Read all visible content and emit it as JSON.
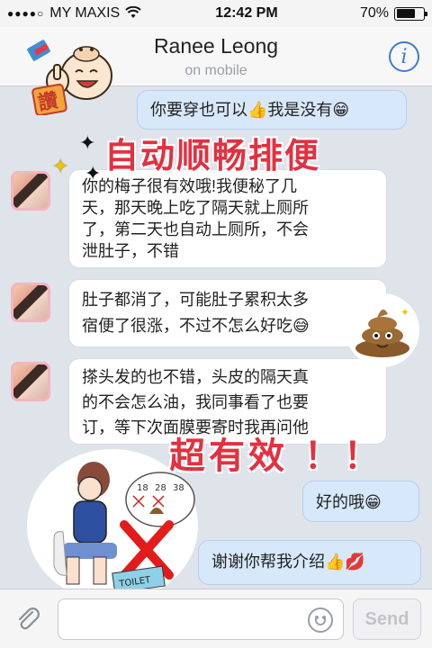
{
  "status_bar": {
    "signal": "●●●●○",
    "carrier": "MY MAXIS",
    "time": "12:42 PM",
    "battery_text": "70%",
    "battery_level": 0.7
  },
  "header": {
    "contact_name": "Ranee Leong",
    "presence": "on mobile",
    "info_label": "i"
  },
  "stickers": {
    "praise_badge": "讚"
  },
  "overlays": {
    "headline": "自动顺畅排便",
    "effective": "超有效 ！！"
  },
  "messages": [
    {
      "dir": "out",
      "text": "你要穿也可以👍我是没有😁"
    },
    {
      "dir": "in",
      "lines": [
        "你的梅子很有效哦!我便秘了几",
        "天，那天晚上吃了隔天就上厕所",
        "了，第二天也自动上厕所，不会",
        "泄肚子，不错"
      ]
    },
    {
      "dir": "in",
      "lines": [
        "肚子都消了，可能肚子累积太多",
        "宿便了很涨，不过不怎么好吃😅"
      ]
    },
    {
      "dir": "in",
      "lines": [
        "搽头发的也不错，头皮的隔天真",
        "的不会怎么油，我同事看了也要",
        "订，等下次面膜要寄时我再问他"
      ]
    },
    {
      "dir": "out",
      "text": "好的哦😁"
    },
    {
      "dir": "out",
      "text": "谢谢你帮我介绍👍💋"
    }
  ],
  "cartoon": {
    "calendar_numbers": [
      "18",
      "28",
      "38"
    ],
    "toilet_sign": "TOILET"
  },
  "input_bar": {
    "placeholder": "",
    "send_label": "Send"
  }
}
